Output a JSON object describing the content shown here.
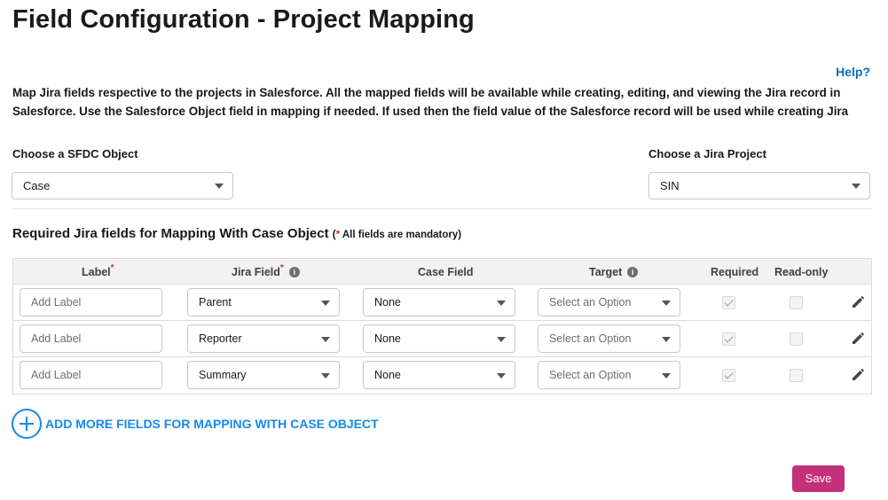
{
  "page_title": "Field Configuration - Project Mapping",
  "help_link": "Help?",
  "description": {
    "line1": "Map Jira fields respective to the projects in Salesforce. All the mapped fields will be available while creating, editing, and viewing the Jira record in",
    "line2": "Salesforce. Use the Salesforce Object field in mapping if needed. If used then the field value of the Salesforce record will be used while creating Jira"
  },
  "sfdc_object": {
    "label": "Choose a SFDC Object",
    "value": "Case"
  },
  "jira_project": {
    "label": "Choose a Jira Project",
    "value": "SIN"
  },
  "section": {
    "title": "Required Jira fields for Mapping With Case Object",
    "mandatory_open": "(",
    "mandatory_star": "*",
    "mandatory_text": " All fields are mandatory)"
  },
  "table": {
    "headers": {
      "label": "Label",
      "jira_field": "Jira Field",
      "case_field": "Case Field",
      "target": "Target",
      "required": "Required",
      "read_only": "Read-only"
    },
    "required_mark": "*",
    "info_glyph": "i",
    "rows": [
      {
        "label_placeholder": "Add Label",
        "jira_field": "Parent",
        "case_field": "None",
        "target": "Select an Option",
        "required": true,
        "read_only": false
      },
      {
        "label_placeholder": "Add Label",
        "jira_field": "Reporter",
        "case_field": "None",
        "target": "Select an Option",
        "required": true,
        "read_only": false
      },
      {
        "label_placeholder": "Add Label",
        "jira_field": "Summary",
        "case_field": "None",
        "target": "Select an Option",
        "required": true,
        "read_only": false
      }
    ]
  },
  "add_more": {
    "label": "ADD MORE FIELDS FOR MAPPING WITH CASE OBJECT",
    "icon": "plus-circle-icon"
  },
  "save_label": "Save",
  "colors": {
    "link_blue": "#0a6bb8",
    "accent_blue": "#1589ee",
    "save_magenta": "#c4307a",
    "required_red": "#c23934"
  }
}
